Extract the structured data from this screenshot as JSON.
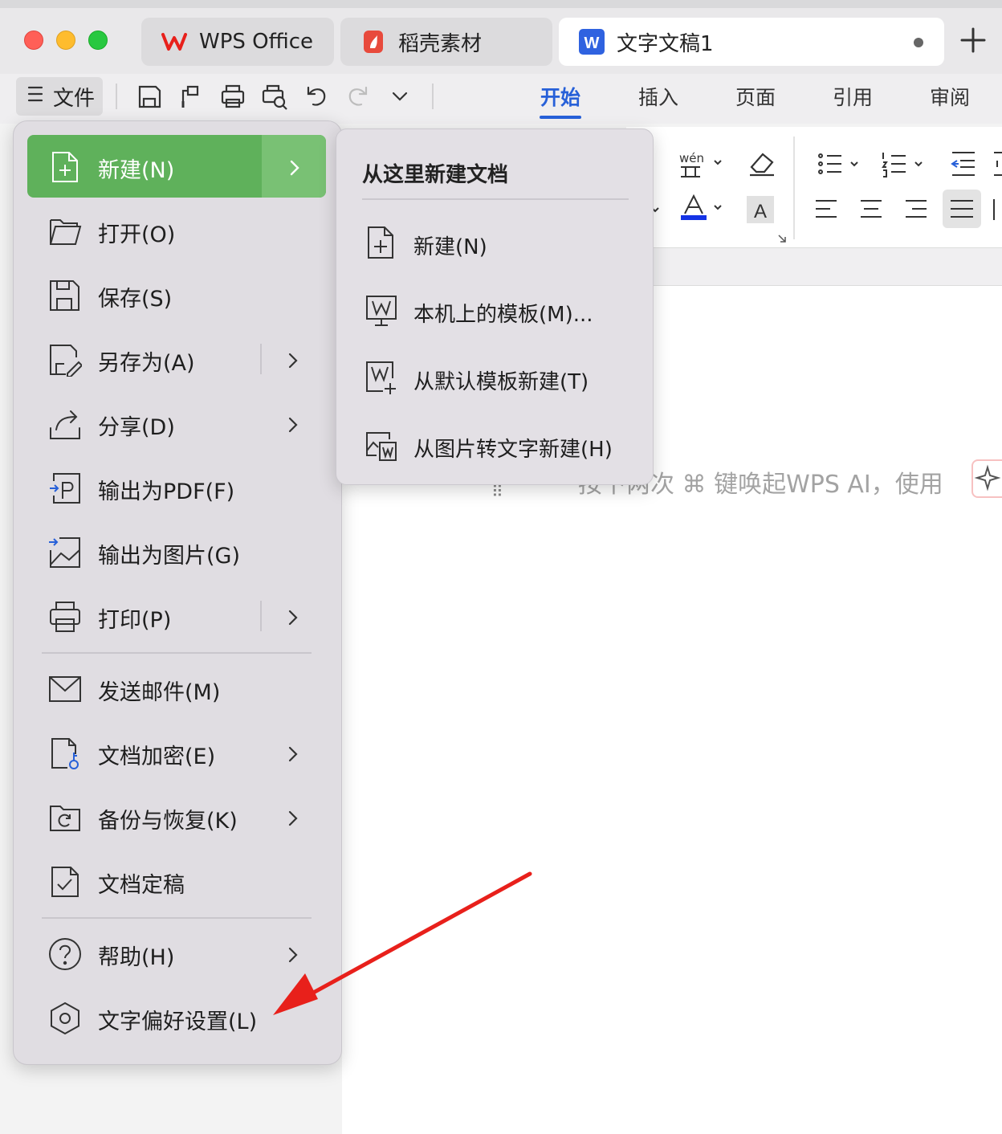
{
  "tabs": [
    {
      "label": "WPS Office",
      "icon": "wps-logo"
    },
    {
      "label": "稻壳素材",
      "icon": "docer-logo"
    },
    {
      "label": "文字文稿1",
      "icon": "writer-logo",
      "active": true
    }
  ],
  "toolbar": {
    "file_label": "文件",
    "ribbon_tabs": [
      "开始",
      "插入",
      "页面",
      "引用",
      "审阅"
    ],
    "active_ribbon_tab": "开始"
  },
  "file_menu": {
    "items": [
      {
        "label": "新建(N)",
        "icon": "new-doc-icon",
        "has_submenu": true,
        "selected": true
      },
      {
        "label": "打开(O)",
        "icon": "open-folder-icon"
      },
      {
        "label": "保存(S)",
        "icon": "save-icon"
      },
      {
        "label": "另存为(A)",
        "icon": "save-as-icon",
        "has_submenu": true
      },
      {
        "label": "分享(D)",
        "icon": "share-icon",
        "has_submenu": true
      },
      {
        "label": "输出为PDF(F)",
        "icon": "export-pdf-icon"
      },
      {
        "label": "输出为图片(G)",
        "icon": "export-image-icon"
      },
      {
        "label": "打印(P)",
        "icon": "print-icon",
        "has_submenu": true
      },
      {
        "label": "发送邮件(M)",
        "icon": "mail-icon"
      },
      {
        "label": "文档加密(E)",
        "icon": "encrypt-icon",
        "has_submenu": true
      },
      {
        "label": "备份与恢复(K)",
        "icon": "backup-icon",
        "has_submenu": true
      },
      {
        "label": "文档定稿",
        "icon": "finalize-icon"
      },
      {
        "label": "帮助(H)",
        "icon": "help-icon",
        "has_submenu": true
      },
      {
        "label": "文字偏好设置(L)",
        "icon": "settings-icon"
      }
    ]
  },
  "new_submenu": {
    "title": "从这里新建文档",
    "items": [
      {
        "label": "新建(N)",
        "icon": "new-doc-icon"
      },
      {
        "label": "本机上的模板(M)...",
        "icon": "local-template-icon"
      },
      {
        "label": "从默认模板新建(T)",
        "icon": "default-template-icon"
      },
      {
        "label": "从图片转文字新建(H)",
        "icon": "image-to-text-icon"
      }
    ]
  },
  "document": {
    "hint_text": "按下两次 ⌘ 键唤起WPS AI，使用"
  },
  "colors": {
    "accent_blue": "#2760d8",
    "menu_selected_green": "#5fb15b",
    "annotation_arrow": "#e8201b"
  }
}
